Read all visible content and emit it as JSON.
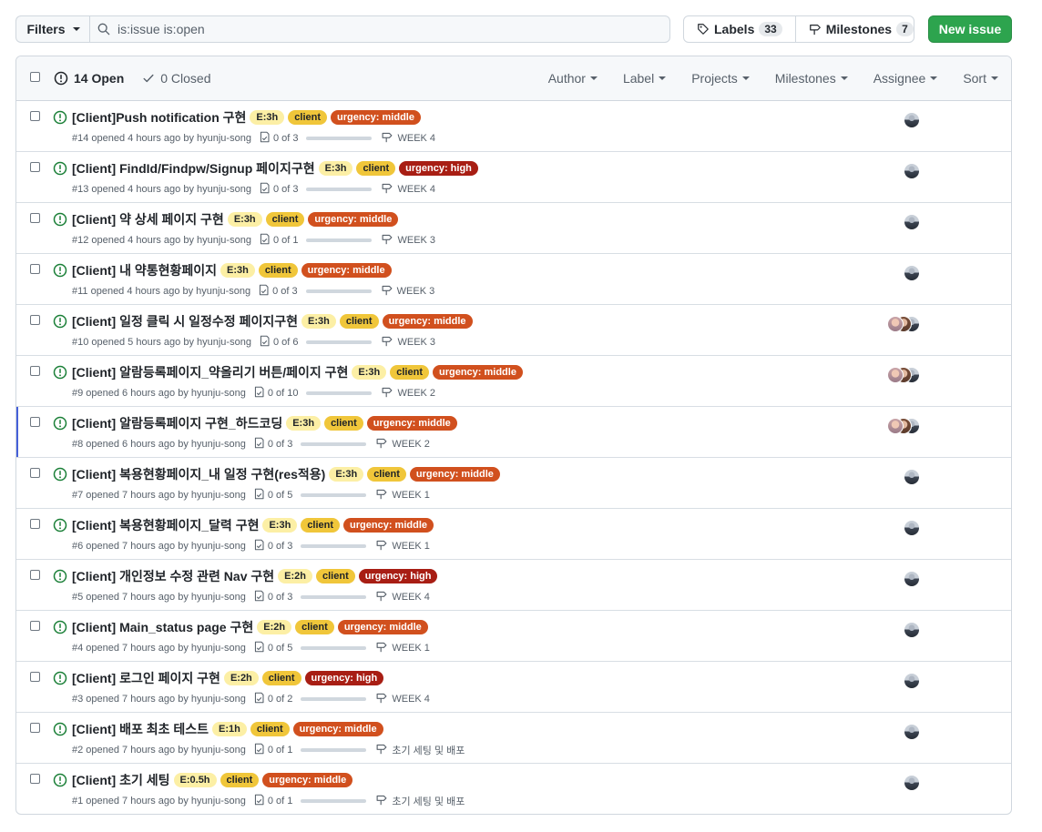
{
  "toolbar": {
    "filters_label": "Filters",
    "search_value": "is:issue is:open",
    "labels_label": "Labels",
    "labels_count": "33",
    "milestones_label": "Milestones",
    "milestones_count": "7",
    "new_issue_label": "New issue"
  },
  "header": {
    "open_label": "14 Open",
    "closed_label": "0 Closed",
    "menus": [
      "Author",
      "Label",
      "Projects",
      "Milestones",
      "Assignee",
      "Sort"
    ]
  },
  "issues": [
    {
      "title": "[Client]Push notification 구현",
      "est": "E:3h",
      "urgency": "urgency: middle",
      "urgency_level": "middle",
      "meta": "#14 opened 4 hours ago by hyunju-song",
      "tasks": "0 of 3",
      "progress": 0,
      "milestone": "WEEK 4",
      "assignees": 1,
      "active": false
    },
    {
      "title": "[Client] FindId/Findpw/Signup 페이지구현",
      "est": "E:3h",
      "urgency": "urgency: high",
      "urgency_level": "high",
      "meta": "#13 opened 4 hours ago by hyunju-song",
      "tasks": "0 of 3",
      "progress": 0,
      "milestone": "WEEK 4",
      "assignees": 1,
      "active": false
    },
    {
      "title": "[Client] 약 상세 페이지 구현",
      "est": "E:3h",
      "urgency": "urgency: middle",
      "urgency_level": "middle",
      "meta": "#12 opened 4 hours ago by hyunju-song",
      "tasks": "0 of 1",
      "progress": 0,
      "milestone": "WEEK 3",
      "assignees": 1,
      "active": false
    },
    {
      "title": "[Client] 내 약통현황페이지",
      "est": "E:3h",
      "urgency": "urgency: middle",
      "urgency_level": "middle",
      "meta": "#11 opened 4 hours ago by hyunju-song",
      "tasks": "0 of 3",
      "progress": 0,
      "milestone": "WEEK 3",
      "assignees": 1,
      "active": false
    },
    {
      "title": "[Client] 일정 클릭 시 일정수정 페이지구현",
      "est": "E:3h",
      "urgency": "urgency: middle",
      "urgency_level": "middle",
      "meta": "#10 opened 5 hours ago by hyunju-song",
      "tasks": "0 of 6",
      "progress": 0,
      "milestone": "WEEK 3",
      "assignees": 3,
      "active": false
    },
    {
      "title": "[Client] 알람등록페이지_약올리기 버튼/페이지 구현",
      "est": "E:3h",
      "urgency": "urgency: middle",
      "urgency_level": "middle",
      "meta": "#9 opened 6 hours ago by hyunju-song",
      "tasks": "0 of 10",
      "progress": 0,
      "milestone": "WEEK 2",
      "assignees": 3,
      "active": false
    },
    {
      "title": "[Client] 알람등록페이지 구현_하드코딩",
      "est": "E:3h",
      "urgency": "urgency: middle",
      "urgency_level": "middle",
      "meta": "#8 opened 6 hours ago by hyunju-song",
      "tasks": "0 of 3",
      "progress": 0,
      "milestone": "WEEK 2",
      "assignees": 3,
      "active": true
    },
    {
      "title": "[Client] 복용현황페이지_내 일정 구현(res적용)",
      "est": "E:3h",
      "urgency": "urgency: middle",
      "urgency_level": "middle",
      "meta": "#7 opened 7 hours ago by hyunju-song",
      "tasks": "0 of 5",
      "progress": 0,
      "milestone": "WEEK 1",
      "assignees": 1,
      "active": false
    },
    {
      "title": "[Client] 복용현황페이지_달력 구현",
      "est": "E:3h",
      "urgency": "urgency: middle",
      "urgency_level": "middle",
      "meta": "#6 opened 7 hours ago by hyunju-song",
      "tasks": "0 of 3",
      "progress": 0,
      "milestone": "WEEK 1",
      "assignees": 1,
      "active": false
    },
    {
      "title": "[Client] 개인정보 수정 관련 Nav 구현",
      "est": "E:2h",
      "urgency": "urgency: high",
      "urgency_level": "high",
      "meta": "#5 opened 7 hours ago by hyunju-song",
      "tasks": "0 of 3",
      "progress": 0,
      "milestone": "WEEK 4",
      "assignees": 1,
      "active": false
    },
    {
      "title": "[Client] Main_status page 구현",
      "est": "E:2h",
      "urgency": "urgency: middle",
      "urgency_level": "middle",
      "meta": "#4 opened 7 hours ago by hyunju-song",
      "tasks": "0 of 5",
      "progress": 0,
      "milestone": "WEEK 1",
      "assignees": 1,
      "active": false
    },
    {
      "title": "[Client] 로그인 페이지 구현",
      "est": "E:2h",
      "urgency": "urgency: high",
      "urgency_level": "high",
      "meta": "#3 opened 7 hours ago by hyunju-song",
      "tasks": "0 of 2",
      "progress": 0,
      "milestone": "WEEK 4",
      "assignees": 1,
      "active": false
    },
    {
      "title": "[Client] 배포 최초 테스트",
      "est": "E:1h",
      "urgency": "urgency: middle",
      "urgency_level": "middle",
      "meta": "#2 opened 7 hours ago by hyunju-song",
      "tasks": "0 of 1",
      "progress": 0,
      "milestone": "초기 세팅 및 배포",
      "assignees": 1,
      "active": false
    },
    {
      "title": "[Client] 초기 세팅",
      "est": "E:0.5h",
      "urgency": "urgency: middle",
      "urgency_level": "middle",
      "meta": "#1 opened 7 hours ago by hyunju-song",
      "tasks": "0 of 1",
      "progress": 0,
      "milestone": "초기 세팅 및 배포",
      "assignees": 1,
      "active": false
    }
  ],
  "client_label": "client",
  "colors": {
    "accent_green": "#2da44e",
    "urgency_middle": "#d1501e",
    "urgency_high": "#a81e14",
    "client": "#f0c63a",
    "estimate": "#fcefa5"
  },
  "icons": [
    "search-icon",
    "tag-icon",
    "milestone-icon",
    "issue-opened-icon",
    "check-icon",
    "checklist-icon"
  ]
}
